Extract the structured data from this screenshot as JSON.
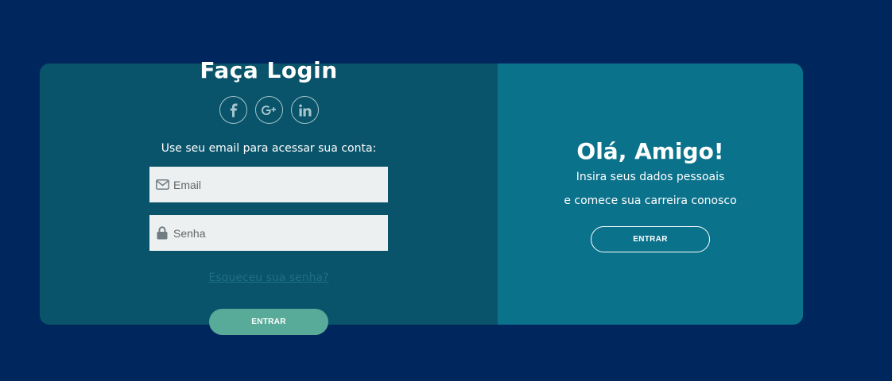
{
  "login": {
    "title": "Faça Login",
    "socials": [
      {
        "icon": "facebook-icon"
      },
      {
        "icon": "google-plus-icon"
      },
      {
        "icon": "linkedin-icon"
      }
    ],
    "subtitle": "Use seu email para acessar sua conta:",
    "email": {
      "placeholder": "Email",
      "value": "",
      "icon": "envelope-icon"
    },
    "password": {
      "placeholder": "Senha",
      "value": "",
      "icon": "lock-icon"
    },
    "forgot_link": "Esqueceu sua senha?",
    "button_label": "ENTRAR"
  },
  "signup": {
    "title": "Olá, Amigo!",
    "line1": "Insira seus dados pessoais",
    "line2": "e comece sua carreira conosco",
    "button_label": "ENTRAR"
  },
  "colors": {
    "page_background": "#00265e",
    "left_panel": "#09546a",
    "right_panel": "#0b728b",
    "input_background": "#ecf0f1",
    "primary_button": "#58ab99"
  }
}
